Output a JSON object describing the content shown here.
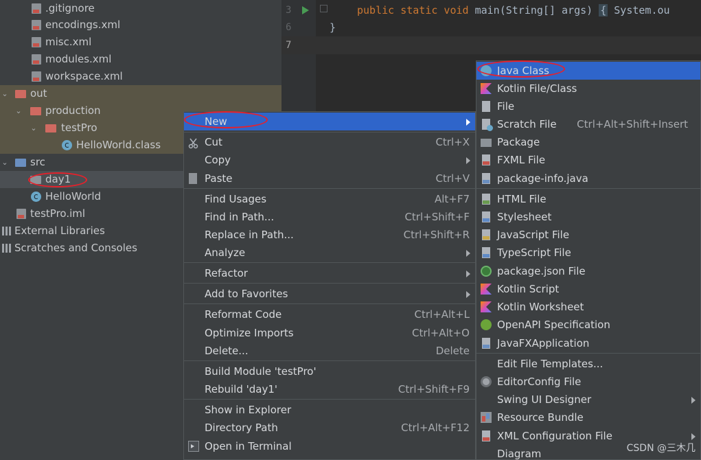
{
  "tree": {
    "items": [
      {
        "label": ".gitignore",
        "icon": "file-icon"
      },
      {
        "label": "encodings.xml",
        "icon": "xml-file-icon"
      },
      {
        "label": "misc.xml",
        "icon": "xml-file-icon"
      },
      {
        "label": "modules.xml",
        "icon": "xml-file-icon"
      },
      {
        "label": "workspace.xml",
        "icon": "xml-file-icon"
      },
      {
        "label": "out",
        "icon": "folder-icon"
      },
      {
        "label": "production",
        "icon": "folder-icon"
      },
      {
        "label": "testPro",
        "icon": "folder-icon"
      },
      {
        "label": "HelloWorld.class",
        "icon": "class-icon"
      },
      {
        "label": "src",
        "icon": "folder-icon"
      },
      {
        "label": "day1",
        "icon": "package-icon"
      },
      {
        "label": "HelloWorld",
        "icon": "class-icon"
      },
      {
        "label": "testPro.iml",
        "icon": "module-file-icon"
      },
      {
        "label": "External Libraries",
        "icon": "libraries-icon"
      },
      {
        "label": "Scratches and Consoles",
        "icon": "scratches-icon"
      }
    ]
  },
  "editor": {
    "lines": [
      {
        "num": "3",
        "code_kw": "public static void",
        "code_rest": " main(String[] args) ",
        "code_brace": "{",
        "code_tail": " System.ou"
      },
      {
        "num": "6",
        "code": "}"
      },
      {
        "num": "7",
        "code": ""
      }
    ]
  },
  "context_menu": {
    "items": [
      {
        "label": "New",
        "shortcut": ""
      },
      {
        "label": "Cut",
        "shortcut": "Ctrl+X"
      },
      {
        "label": "Copy",
        "shortcut": ""
      },
      {
        "label": "Paste",
        "shortcut": "Ctrl+V"
      },
      {
        "label": "Find Usages",
        "shortcut": "Alt+F7"
      },
      {
        "label": "Find in Path...",
        "shortcut": "Ctrl+Shift+F"
      },
      {
        "label": "Replace in Path...",
        "shortcut": "Ctrl+Shift+R"
      },
      {
        "label": "Analyze",
        "shortcut": ""
      },
      {
        "label": "Refactor",
        "shortcut": ""
      },
      {
        "label": "Add to Favorites",
        "shortcut": ""
      },
      {
        "label": "Reformat Code",
        "shortcut": "Ctrl+Alt+L"
      },
      {
        "label": "Optimize Imports",
        "shortcut": "Ctrl+Alt+O"
      },
      {
        "label": "Delete...",
        "shortcut": "Delete"
      },
      {
        "label": "Build Module 'testPro'",
        "shortcut": ""
      },
      {
        "label": "Rebuild 'day1'",
        "shortcut": "Ctrl+Shift+F9"
      },
      {
        "label": "Show in Explorer",
        "shortcut": ""
      },
      {
        "label": "Directory Path",
        "shortcut": "Ctrl+Alt+F12"
      },
      {
        "label": "Open in Terminal",
        "shortcut": ""
      }
    ]
  },
  "new_submenu": {
    "items": [
      {
        "label": "Java Class",
        "shortcut": ""
      },
      {
        "label": "Kotlin File/Class",
        "shortcut": ""
      },
      {
        "label": "File",
        "shortcut": ""
      },
      {
        "label": "Scratch File",
        "shortcut": "Ctrl+Alt+Shift+Insert"
      },
      {
        "label": "Package",
        "shortcut": ""
      },
      {
        "label": "FXML File",
        "shortcut": ""
      },
      {
        "label": "package-info.java",
        "shortcut": ""
      },
      {
        "label": "HTML File",
        "shortcut": ""
      },
      {
        "label": "Stylesheet",
        "shortcut": ""
      },
      {
        "label": "JavaScript File",
        "shortcut": ""
      },
      {
        "label": "TypeScript File",
        "shortcut": ""
      },
      {
        "label": "package.json File",
        "shortcut": ""
      },
      {
        "label": "Kotlin Script",
        "shortcut": ""
      },
      {
        "label": "Kotlin Worksheet",
        "shortcut": ""
      },
      {
        "label": "OpenAPI Specification",
        "shortcut": ""
      },
      {
        "label": "JavaFXApplication",
        "shortcut": ""
      },
      {
        "label": "Edit File Templates...",
        "shortcut": ""
      },
      {
        "label": "EditorConfig File",
        "shortcut": ""
      },
      {
        "label": "Swing UI Designer",
        "shortcut": ""
      },
      {
        "label": "Resource Bundle",
        "shortcut": ""
      },
      {
        "label": "XML Configuration File",
        "shortcut": ""
      },
      {
        "label": "Diagram",
        "shortcut": ""
      }
    ]
  },
  "watermark": "CSDN @三木几",
  "colors": {
    "menu_bg": "#3c3f41",
    "selection": "#2f65ca",
    "annotation": "#e8202a",
    "out_folder_bg": "#595545"
  }
}
